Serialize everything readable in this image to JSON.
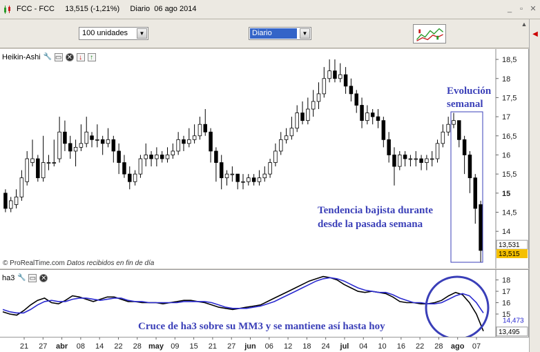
{
  "window": {
    "title": "FCC - FCC     13,515 (-1,21%)     Diario  06 ago 2014"
  },
  "toolbar": {
    "quantity_value": "100 unidades",
    "period_value": "Diario"
  },
  "price_panel": {
    "name": "Heikin-Ashi",
    "copyright": "© ProRealTime.com",
    "copyright_note": "Datos recibidos en fin de día"
  },
  "indicator_panel": {
    "name": "ha3"
  },
  "annotations": {
    "weekly_title_1": "Evolución",
    "weekly_title_2": "semanal",
    "trend_1": "Tendencia bajista durante",
    "trend_2": "desde la pasada semana",
    "cross": "Cruce de ha3 sobre su MM3 y se mantiene así hasta hoy"
  },
  "colors": {
    "annotation": "#3a3fb8",
    "ma_line": "#2a2ad0",
    "last_price_bg": "#f5c000"
  },
  "chart_data": [
    {
      "type": "candlestick",
      "style": "Heikin-Ashi",
      "y_ticks": [
        "18,5",
        "18",
        "17,5",
        "17",
        "16,5",
        "16",
        "15,5",
        "15",
        "14,5",
        "14"
      ],
      "ylim": [
        13.1,
        18.7
      ],
      "last_label_1": "13,531",
      "last_label_2": "13,515",
      "candles": [
        {
          "o": 15.0,
          "c": 14.6,
          "h": 15.1,
          "l": 14.5
        },
        {
          "o": 14.6,
          "c": 14.8,
          "h": 14.9,
          "l": 14.5
        },
        {
          "o": 14.7,
          "c": 14.9,
          "h": 15.1,
          "l": 14.6
        },
        {
          "o": 14.9,
          "c": 15.4,
          "h": 15.6,
          "l": 14.8
        },
        {
          "o": 15.3,
          "c": 15.9,
          "h": 16.1,
          "l": 15.2
        },
        {
          "o": 15.8,
          "c": 15.9,
          "h": 16.4,
          "l": 15.7
        },
        {
          "o": 15.9,
          "c": 15.4,
          "h": 16.0,
          "l": 15.3
        },
        {
          "o": 15.4,
          "c": 15.8,
          "h": 16.5,
          "l": 15.3
        },
        {
          "o": 15.8,
          "c": 15.8,
          "h": 16.0,
          "l": 15.6
        },
        {
          "o": 15.8,
          "c": 15.8,
          "h": 16.4,
          "l": 15.7
        },
        {
          "o": 15.9,
          "c": 16.6,
          "h": 17.0,
          "l": 15.8
        },
        {
          "o": 16.6,
          "c": 16.3,
          "h": 16.9,
          "l": 16.1
        },
        {
          "o": 16.3,
          "c": 16.1,
          "h": 16.5,
          "l": 15.9
        },
        {
          "o": 16.1,
          "c": 16.2,
          "h": 16.4,
          "l": 15.7
        },
        {
          "o": 16.2,
          "c": 16.3,
          "h": 16.8,
          "l": 16.1
        },
        {
          "o": 16.3,
          "c": 16.6,
          "h": 17.0,
          "l": 16.2
        },
        {
          "o": 16.5,
          "c": 16.4,
          "h": 16.6,
          "l": 16.2
        },
        {
          "o": 16.4,
          "c": 16.4,
          "h": 16.8,
          "l": 16.2
        },
        {
          "o": 16.4,
          "c": 16.3,
          "h": 16.5,
          "l": 16.0
        },
        {
          "o": 16.3,
          "c": 16.4,
          "h": 16.7,
          "l": 16.2
        },
        {
          "o": 16.4,
          "c": 16.1,
          "h": 16.5,
          "l": 15.8
        },
        {
          "o": 16.1,
          "c": 15.8,
          "h": 16.3,
          "l": 15.5
        },
        {
          "o": 15.8,
          "c": 15.5,
          "h": 16.0,
          "l": 15.4
        },
        {
          "o": 15.5,
          "c": 15.3,
          "h": 15.7,
          "l": 15.1
        },
        {
          "o": 15.3,
          "c": 15.5,
          "h": 15.6,
          "l": 15.2
        },
        {
          "o": 15.5,
          "c": 15.9,
          "h": 16.0,
          "l": 15.4
        },
        {
          "o": 15.9,
          "c": 16.0,
          "h": 16.3,
          "l": 15.7
        },
        {
          "o": 16.0,
          "c": 15.9,
          "h": 16.1,
          "l": 15.7
        },
        {
          "o": 15.9,
          "c": 16.0,
          "h": 16.2,
          "l": 15.7
        },
        {
          "o": 16.0,
          "c": 15.9,
          "h": 16.1,
          "l": 15.8
        },
        {
          "o": 15.9,
          "c": 16.0,
          "h": 16.2,
          "l": 15.8
        },
        {
          "o": 16.0,
          "c": 16.1,
          "h": 16.3,
          "l": 15.9
        },
        {
          "o": 16.1,
          "c": 16.4,
          "h": 16.6,
          "l": 16.0
        },
        {
          "o": 16.4,
          "c": 16.3,
          "h": 16.5,
          "l": 16.1
        },
        {
          "o": 16.3,
          "c": 16.4,
          "h": 16.7,
          "l": 16.2
        },
        {
          "o": 16.4,
          "c": 16.5,
          "h": 16.8,
          "l": 16.3
        },
        {
          "o": 16.5,
          "c": 16.8,
          "h": 17.0,
          "l": 16.4
        },
        {
          "o": 16.8,
          "c": 16.6,
          "h": 17.2,
          "l": 16.5
        },
        {
          "o": 16.6,
          "c": 16.1,
          "h": 16.7,
          "l": 15.8
        },
        {
          "o": 16.1,
          "c": 15.8,
          "h": 16.2,
          "l": 15.3
        },
        {
          "o": 15.8,
          "c": 15.4,
          "h": 16.0,
          "l": 15.1
        },
        {
          "o": 15.4,
          "c": 15.5,
          "h": 15.6,
          "l": 15.2
        },
        {
          "o": 15.5,
          "c": 15.5,
          "h": 15.7,
          "l": 15.3
        },
        {
          "o": 15.5,
          "c": 15.3,
          "h": 15.5,
          "l": 15.1
        },
        {
          "o": 15.3,
          "c": 15.3,
          "h": 15.5,
          "l": 15.1
        },
        {
          "o": 15.3,
          "c": 15.4,
          "h": 15.5,
          "l": 15.2
        },
        {
          "o": 15.4,
          "c": 15.3,
          "h": 15.5,
          "l": 15.2
        },
        {
          "o": 15.3,
          "c": 15.4,
          "h": 15.6,
          "l": 15.2
        },
        {
          "o": 15.4,
          "c": 15.5,
          "h": 15.7,
          "l": 15.3
        },
        {
          "o": 15.5,
          "c": 15.8,
          "h": 15.9,
          "l": 15.4
        },
        {
          "o": 15.8,
          "c": 16.1,
          "h": 16.3,
          "l": 15.7
        },
        {
          "o": 16.1,
          "c": 16.4,
          "h": 16.6,
          "l": 16.0
        },
        {
          "o": 16.4,
          "c": 16.5,
          "h": 16.7,
          "l": 16.3
        },
        {
          "o": 16.5,
          "c": 16.7,
          "h": 17.0,
          "l": 16.4
        },
        {
          "o": 16.7,
          "c": 17.1,
          "h": 17.3,
          "l": 16.6
        },
        {
          "o": 17.1,
          "c": 16.9,
          "h": 17.4,
          "l": 16.8
        },
        {
          "o": 16.9,
          "c": 17.2,
          "h": 17.5,
          "l": 16.8
        },
        {
          "o": 17.2,
          "c": 17.4,
          "h": 17.7,
          "l": 17.0
        },
        {
          "o": 17.4,
          "c": 17.6,
          "h": 17.9,
          "l": 17.2
        },
        {
          "o": 17.6,
          "c": 18.0,
          "h": 18.3,
          "l": 17.5
        },
        {
          "o": 18.0,
          "c": 18.2,
          "h": 18.5,
          "l": 17.9
        },
        {
          "o": 18.2,
          "c": 18.0,
          "h": 18.5,
          "l": 17.9
        },
        {
          "o": 18.0,
          "c": 18.1,
          "h": 18.4,
          "l": 17.9
        },
        {
          "o": 18.1,
          "c": 17.8,
          "h": 18.3,
          "l": 17.6
        },
        {
          "o": 17.8,
          "c": 17.6,
          "h": 18.0,
          "l": 17.4
        },
        {
          "o": 17.6,
          "c": 17.3,
          "h": 17.7,
          "l": 17.1
        },
        {
          "o": 17.3,
          "c": 16.9,
          "h": 17.5,
          "l": 16.7
        },
        {
          "o": 16.9,
          "c": 17.1,
          "h": 17.3,
          "l": 16.8
        },
        {
          "o": 17.1,
          "c": 17.0,
          "h": 17.2,
          "l": 16.8
        },
        {
          "o": 17.0,
          "c": 16.9,
          "h": 17.2,
          "l": 16.7
        },
        {
          "o": 16.9,
          "c": 16.4,
          "h": 17.0,
          "l": 16.2
        },
        {
          "o": 16.4,
          "c": 16.0,
          "h": 16.6,
          "l": 15.8
        },
        {
          "o": 16.0,
          "c": 15.7,
          "h": 16.2,
          "l": 15.2
        },
        {
          "o": 15.7,
          "c": 16.0,
          "h": 16.1,
          "l": 15.6
        },
        {
          "o": 16.0,
          "c": 15.9,
          "h": 16.1,
          "l": 15.7
        },
        {
          "o": 15.9,
          "c": 15.9,
          "h": 16.0,
          "l": 15.7
        },
        {
          "o": 15.9,
          "c": 15.9,
          "h": 16.1,
          "l": 15.7
        },
        {
          "o": 15.9,
          "c": 15.8,
          "h": 16.0,
          "l": 15.6
        },
        {
          "o": 15.8,
          "c": 15.9,
          "h": 16.0,
          "l": 15.6
        },
        {
          "o": 15.9,
          "c": 15.9,
          "h": 16.1,
          "l": 15.7
        },
        {
          "o": 15.9,
          "c": 16.3,
          "h": 16.4,
          "l": 15.8
        },
        {
          "o": 16.3,
          "c": 16.6,
          "h": 16.8,
          "l": 16.2
        },
        {
          "o": 16.6,
          "c": 16.8,
          "h": 17.0,
          "l": 16.5
        },
        {
          "o": 16.8,
          "c": 16.9,
          "h": 17.1,
          "l": 16.7
        },
        {
          "o": 16.9,
          "c": 16.4,
          "h": 16.9,
          "l": 16.2
        },
        {
          "o": 16.4,
          "c": 16.0,
          "h": 16.5,
          "l": 15.5
        },
        {
          "o": 16.0,
          "c": 15.4,
          "h": 16.1,
          "l": 15.0
        },
        {
          "o": 15.4,
          "c": 14.6,
          "h": 15.5,
          "l": 14.2
        },
        {
          "o": 14.7,
          "c": 13.5,
          "h": 14.8,
          "l": 13.2
        }
      ]
    },
    {
      "type": "line",
      "indicator": "ha3",
      "y_ticks": [
        "18",
        "17",
        "16",
        "15"
      ],
      "ylim": [
        13.3,
        18.4
      ],
      "last_label_1": "14,473",
      "last_label_2": "13,495",
      "series": [
        {
          "values": [
            15.2,
            15.0,
            14.9,
            15.3,
            15.8,
            16.2,
            16.4,
            16.0,
            15.9,
            16.2,
            16.6,
            16.5,
            16.3,
            16.1,
            16.3,
            16.5,
            16.5,
            16.3,
            16.1,
            16.1,
            16.0,
            16.0,
            16.0,
            15.9,
            16.0,
            16.1,
            16.2,
            16.2,
            16.1,
            16.0,
            15.8,
            15.6,
            15.5,
            15.4,
            15.5,
            15.6,
            15.7,
            15.8,
            16.1,
            16.4,
            16.7,
            17.0,
            17.3,
            17.6,
            17.9,
            18.1,
            18.3,
            18.2,
            18.0,
            17.6,
            17.3,
            17.0,
            16.9,
            17.0,
            16.9,
            16.8,
            16.5,
            16.1,
            16.0,
            16.0,
            15.9,
            15.9,
            16.0,
            16.2,
            16.6,
            16.9,
            16.7,
            16.0,
            15.0,
            13.5
          ]
        },
        {
          "values": [
            15.4,
            15.2,
            15.1,
            15.1,
            15.4,
            15.8,
            16.1,
            16.2,
            16.1,
            16.1,
            16.3,
            16.4,
            16.4,
            16.3,
            16.2,
            16.3,
            16.4,
            16.4,
            16.2,
            16.1,
            16.1,
            16.0,
            16.0,
            16.0,
            16.0,
            16.0,
            16.1,
            16.1,
            16.1,
            16.1,
            16.0,
            15.8,
            15.6,
            15.5,
            15.5,
            15.5,
            15.6,
            15.7,
            15.9,
            16.1,
            16.4,
            16.7,
            17.0,
            17.3,
            17.6,
            17.9,
            18.1,
            18.2,
            18.1,
            17.9,
            17.6,
            17.3,
            17.1,
            17.0,
            16.9,
            16.9,
            16.7,
            16.4,
            16.2,
            16.0,
            16.0,
            15.9,
            15.9,
            16.0,
            16.3,
            16.6,
            16.8,
            16.6,
            16.0,
            15.1
          ]
        }
      ]
    }
  ],
  "date_axis": [
    "21",
    "27",
    "abr",
    "08",
    "14",
    "22",
    "28",
    "may",
    "09",
    "15",
    "21",
    "27",
    "jun",
    "06",
    "12",
    "18",
    "24",
    "jul",
    "04",
    "10",
    "16",
    "22",
    "28",
    "ago",
    "07"
  ]
}
